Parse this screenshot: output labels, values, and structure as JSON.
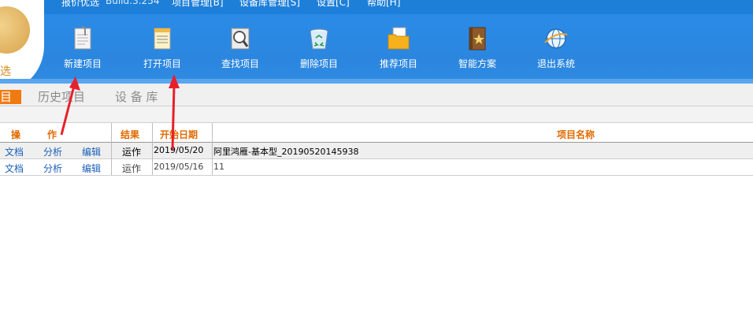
{
  "menubar": {
    "left_label": "报价优选",
    "build": "Build:3.254",
    "items": [
      "项目管理[B]",
      "设备库管理[S]",
      "设置[C]",
      "帮助[H]"
    ]
  },
  "logo": {
    "text": "选"
  },
  "toolbar": {
    "new_project": "新建项目",
    "open_project": "打开项目",
    "find_project": "查找项目",
    "delete_project": "删除项目",
    "recommend_project": "推荐项目",
    "smart_solution": "智能方案",
    "exit_system": "退出系统"
  },
  "tabs": {
    "current": "目",
    "history": "历史项目",
    "device_library": "设 备 库"
  },
  "table": {
    "headers": {
      "op1": "操",
      "op2": "作",
      "result": "结果",
      "start_date": "开始日期",
      "project_name": "项目名称"
    },
    "rows": [
      {
        "doc": "文档",
        "analyze": "分析",
        "edit": "编辑",
        "result": "运作",
        "date": "2019/05/20",
        "name": "阿里鸿雁-基本型_20190520145938"
      },
      {
        "doc": "文档",
        "analyze": "分析",
        "edit": "编辑",
        "result": "运作",
        "date": "2019/05/16",
        "name": "11"
      }
    ]
  },
  "colors": {
    "toolbar_blue": "#2b86df",
    "accent_orange": "#f07a10",
    "header_orange": "#e06a00",
    "link_blue": "#1b5fb8",
    "arrow_red": "#e8202a"
  }
}
